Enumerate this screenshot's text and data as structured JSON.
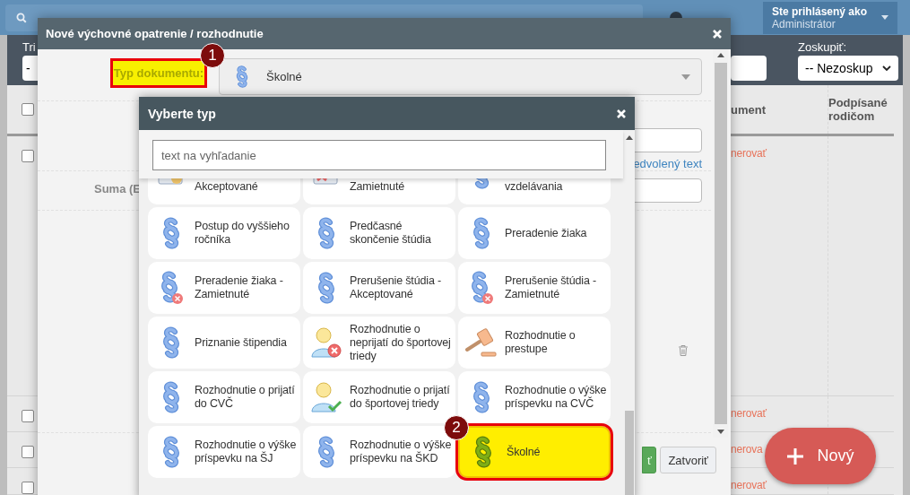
{
  "top_bar": {
    "user_label": "Ste prihlásený ako",
    "user_name": "Administrátor"
  },
  "filter_bar": {
    "sort_label": "Tri",
    "sort_value": "-",
    "group_label": "Zoskupiť:",
    "group_value": "-- Nezoskup"
  },
  "table": {
    "select_all_checked": false,
    "columns": [
      "ument",
      "Podpísané rodičom"
    ],
    "rows": [
      {
        "checked": false,
        "action": "nerovať"
      },
      {
        "checked": false,
        "action": "nerovať"
      },
      {
        "checked": false,
        "action": "nerova"
      },
      {
        "checked": false,
        "action": "nerovať"
      }
    ]
  },
  "new_button": {
    "label": "Nový"
  },
  "dialog": {
    "title": "Nové výchovné opatrenie / rozhodnutie",
    "type_label": {
      "text": "Typ dokumentu:",
      "highlighted": true,
      "callout": "1"
    },
    "type_value": "Školné",
    "default_text_link": "edvolený text",
    "amount_label": "Suma (E",
    "buttons": [
      {
        "label": "ť",
        "kind": "primary"
      },
      {
        "label": "Zatvoriť",
        "kind": "secondary"
      }
    ]
  },
  "picker": {
    "title": "Vyberte typ",
    "search_placeholder": "text na vyhľadanie",
    "tiles": [
      {
        "label": "Akceptované",
        "kind": "document-check",
        "selected": false
      },
      {
        "label": "Zamietnuté",
        "kind": "document-x",
        "selected": false
      },
      {
        "label": "vzdelávania",
        "kind": "paragraph",
        "selected": false
      },
      {
        "label": "Postup do vyššieho ročníka",
        "kind": "paragraph",
        "selected": false
      },
      {
        "label": "Predčasné skončenie štúdia",
        "kind": "paragraph",
        "selected": false
      },
      {
        "label": "Preradenie žiaka",
        "kind": "paragraph",
        "selected": false
      },
      {
        "label": "Preradenie žiaka - Zamietnuté",
        "kind": "paragraph-x",
        "selected": false
      },
      {
        "label": "Prerušenie štúdia - Akceptované",
        "kind": "paragraph",
        "selected": false
      },
      {
        "label": "Prerušenie štúdia - Zamietnuté",
        "kind": "paragraph-x",
        "selected": false
      },
      {
        "label": "Priznanie štipendia",
        "kind": "paragraph",
        "selected": false
      },
      {
        "label": "Rozhodnutie o neprijatí do športovej triedy",
        "kind": "person-x",
        "selected": false
      },
      {
        "label": "Rozhodnutie o prestupe",
        "kind": "gavel",
        "selected": false
      },
      {
        "label": "Rozhodnutie o prijatí do CVČ",
        "kind": "paragraph",
        "selected": false
      },
      {
        "label": "Rozhodnutie o prijatí do športovej triedy",
        "kind": "person-check",
        "selected": false
      },
      {
        "label": "Rozhodnutie o výške príspevku na CVČ",
        "kind": "paragraph",
        "selected": false
      },
      {
        "label": "Rozhodnutie o výške príspevku na ŠJ",
        "kind": "paragraph",
        "selected": false
      },
      {
        "label": "Rozhodnutie o výške príspevku na ŠKD",
        "kind": "paragraph",
        "selected": false
      },
      {
        "label": "Školné",
        "kind": "paragraph",
        "selected": true,
        "callout": "2"
      }
    ]
  }
}
